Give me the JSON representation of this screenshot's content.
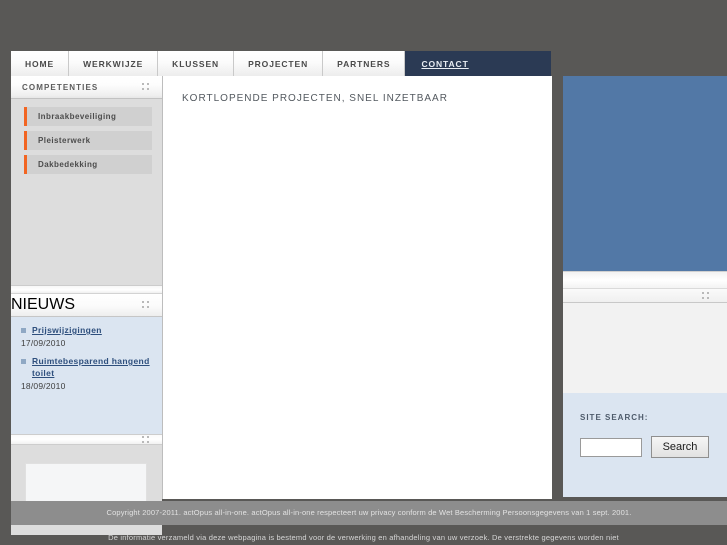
{
  "nav": {
    "tabs": [
      {
        "label": "HOME",
        "active": false
      },
      {
        "label": "WERKWIJZE",
        "active": false
      },
      {
        "label": "KLUSSEN",
        "active": false
      },
      {
        "label": "PROJECTEN",
        "active": false
      },
      {
        "label": "PARTNERS",
        "active": false
      },
      {
        "label": "CONTACT",
        "active": true
      }
    ]
  },
  "sidebar": {
    "competencies": {
      "title": "COMPETENTIES",
      "items": [
        {
          "label": "Inbraakbeveiliging"
        },
        {
          "label": "Pleisterwerk"
        },
        {
          "label": "Dakbedekking"
        }
      ]
    },
    "news": {
      "title": "NIEUWS",
      "items": [
        {
          "link": "Prijswijzigingen",
          "date": "17/09/2010"
        },
        {
          "link": "Ruimtebesparend hangend toilet",
          "date": "18/09/2010"
        }
      ]
    }
  },
  "main": {
    "title": "KORTLOPENDE PROJECTEN, SNEL INZETBAAR"
  },
  "search": {
    "label": "SITE SEARCH:",
    "value": "",
    "placeholder": "",
    "button_label": "Search"
  },
  "footer": {
    "line1": "Copyright 2007-2011. actOpus all-in-one. actOpus all-in-one respecteert uw privacy conform de Wet Bescherming Persoonsgegevens van 1 sept. 2001.",
    "line2": "De informatie verzameld via deze webpagina is bestemd voor de verwerking en afhandeling van uw verzoek. De verstrekte gegevens worden niet"
  },
  "colors": {
    "page_background": "#595856",
    "active_tab": "#2b3a54",
    "accent_orange": "#f26522",
    "panel_blue": "#5278a6",
    "news_blue": "#dbe5f1",
    "sidebar_gray": "#dddddd"
  },
  "icons": {
    "grip": "grip-dots-icon",
    "bullet": "square-bullet-icon"
  }
}
